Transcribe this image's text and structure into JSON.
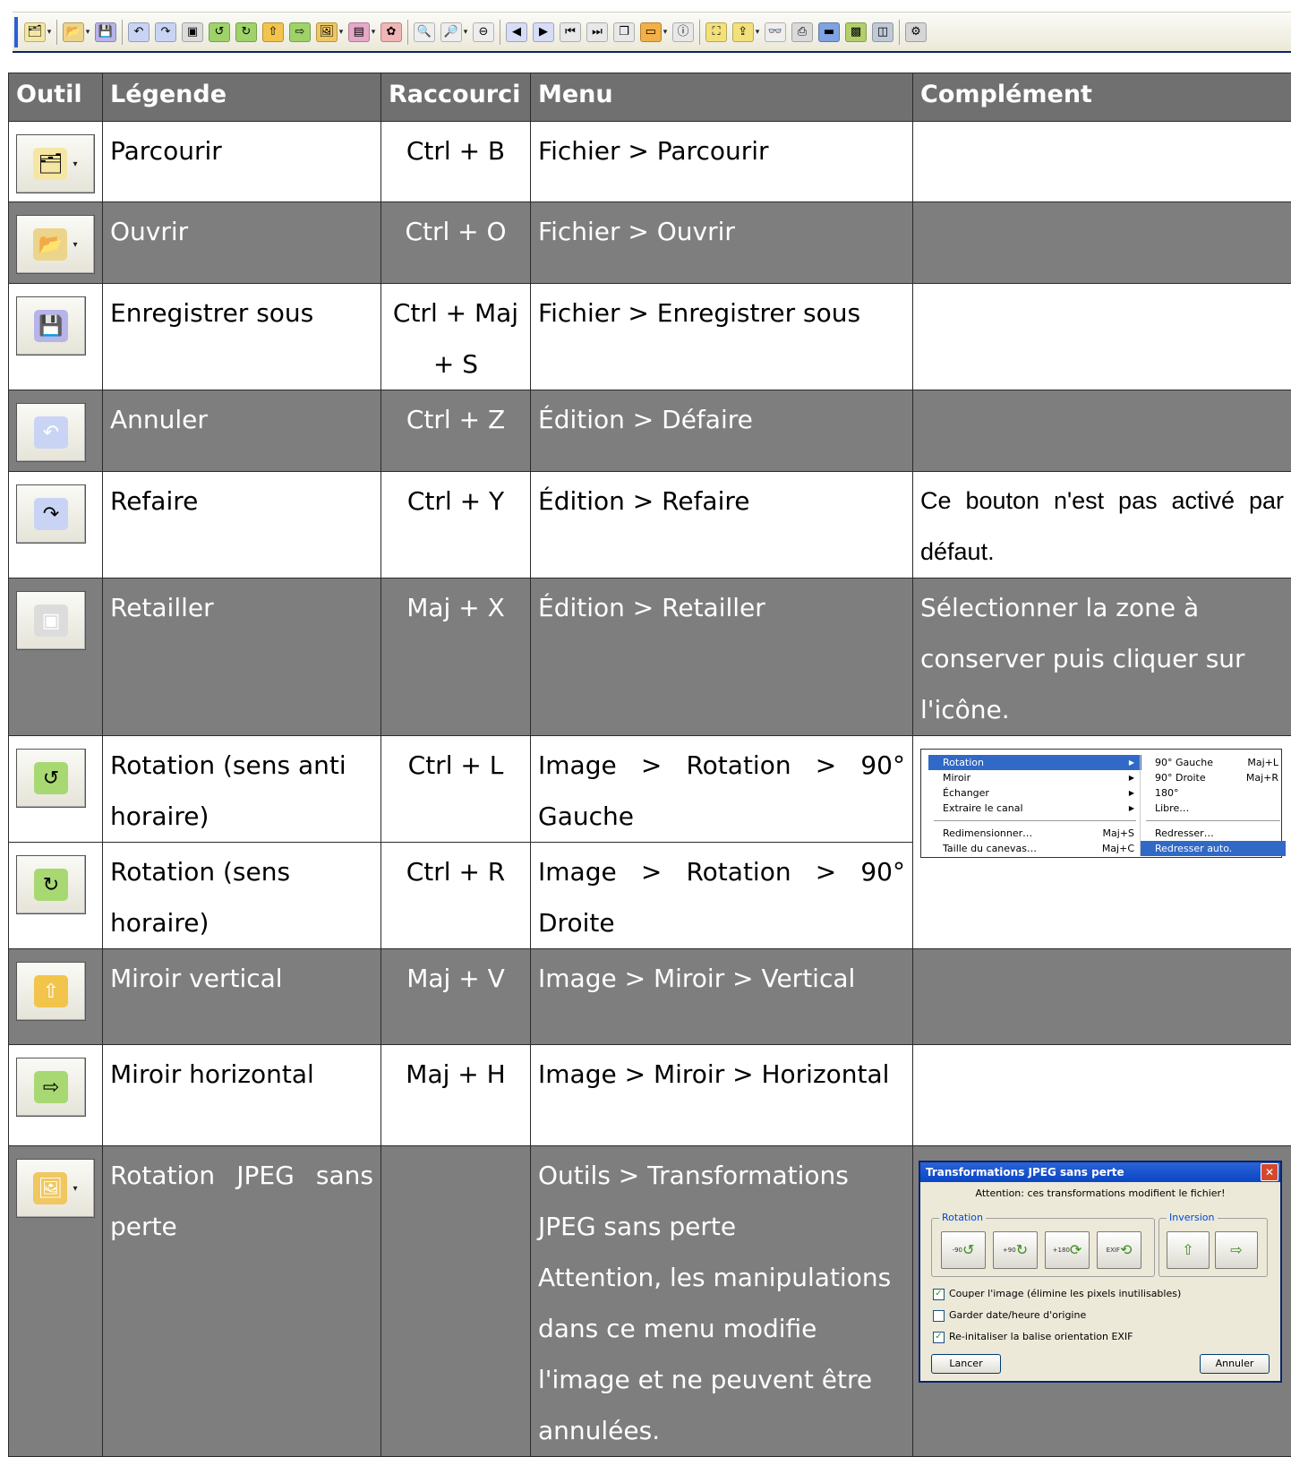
{
  "toolbar": {
    "items": [
      {
        "name": "browse-icon",
        "glyph": "🗂",
        "bg": "#f5e7a3",
        "dropdown": true
      },
      {
        "sep": true
      },
      {
        "name": "open-folder-icon",
        "glyph": "📂",
        "bg": "#ecd48a",
        "dropdown": true
      },
      {
        "name": "save-as-icon",
        "glyph": "💾",
        "bg": "#b7b4ea",
        "dropdown": false
      },
      {
        "sep": true
      },
      {
        "name": "undo-icon",
        "glyph": "↶",
        "bg": "#c9d4f5",
        "dropdown": false
      },
      {
        "name": "redo-icon",
        "glyph": "↷",
        "bg": "#c9d4f5",
        "dropdown": false
      },
      {
        "name": "crop-icon",
        "glyph": "▣",
        "bg": "#dcdcdc",
        "dropdown": false
      },
      {
        "name": "rotate-left-icon",
        "glyph": "↺",
        "bg": "#9fd36a",
        "dropdown": false
      },
      {
        "name": "rotate-right-icon",
        "glyph": "↻",
        "bg": "#9fd36a",
        "dropdown": false
      },
      {
        "name": "mirror-vertical-icon",
        "glyph": "⇧",
        "bg": "#f2c44b",
        "dropdown": false
      },
      {
        "name": "mirror-horizontal-icon",
        "glyph": "⇨",
        "bg": "#9fd36a",
        "dropdown": false
      },
      {
        "name": "jpeg-lossless-icon",
        "glyph": "🖼",
        "bg": "#f0c760",
        "dropdown": true
      },
      {
        "name": "color-icon",
        "glyph": "▤",
        "bg": "#e6a8c8",
        "dropdown": true
      },
      {
        "name": "effects-icon",
        "glyph": "✿",
        "bg": "#f0b5b5",
        "dropdown": false
      },
      {
        "sep": true
      },
      {
        "name": "zoom-in-icon",
        "glyph": "🔍",
        "bg": "#eeeeee",
        "dropdown": false
      },
      {
        "name": "zoom-fit-icon",
        "glyph": "🔎",
        "bg": "#eeeeee",
        "dropdown": true
      },
      {
        "name": "zoom-out-icon",
        "glyph": "⊖",
        "bg": "#eeeeee",
        "dropdown": false
      },
      {
        "sep": true
      },
      {
        "name": "previous-icon",
        "glyph": "◀",
        "bg": "#d7dcf7",
        "dropdown": false
      },
      {
        "name": "next-icon",
        "glyph": "▶",
        "bg": "#d7dcf7",
        "dropdown": false
      },
      {
        "name": "first-icon",
        "glyph": "⏮",
        "bg": "#e8e8e8",
        "dropdown": false
      },
      {
        "name": "last-icon",
        "glyph": "⏭",
        "bg": "#e8e8e8",
        "dropdown": false
      },
      {
        "name": "copy-window-icon",
        "glyph": "❐",
        "bg": "#e8e8e8",
        "dropdown": false
      },
      {
        "name": "slideshow-icon",
        "glyph": "▭",
        "bg": "#f2b048",
        "dropdown": true
      },
      {
        "name": "info-icon",
        "glyph": "ⓘ",
        "bg": "#e8e8e8",
        "dropdown": false
      },
      {
        "sep": true
      },
      {
        "name": "fullscreen-icon",
        "glyph": "⛶",
        "bg": "#f3e07a",
        "dropdown": false
      },
      {
        "name": "export-icon",
        "glyph": "⇪",
        "bg": "#f3e07a",
        "dropdown": true
      },
      {
        "name": "binoculars-icon",
        "glyph": "👓",
        "bg": "#eeeeee",
        "dropdown": false
      },
      {
        "name": "print-icon",
        "glyph": "⎙",
        "bg": "#dadada",
        "dropdown": false
      },
      {
        "name": "scan-icon",
        "glyph": "▬",
        "bg": "#7fa2e0",
        "dropdown": false
      },
      {
        "name": "thumbnails-icon",
        "glyph": "▩",
        "bg": "#b2cf6a",
        "dropdown": false
      },
      {
        "name": "wallpaper-icon",
        "glyph": "◫",
        "bg": "#c0c9d8",
        "dropdown": false
      },
      {
        "sep": true
      },
      {
        "name": "settings-icon",
        "glyph": "⚙",
        "bg": "#d6d6d6",
        "dropdown": false
      }
    ]
  },
  "table": {
    "headers": {
      "tool": "Outil",
      "caption": "Légende",
      "shortcut": "Raccourci",
      "menu": "Menu",
      "extra": "Complément"
    },
    "rows": [
      {
        "icon": "browse-icon",
        "glyph": "🗂",
        "icon_bg": "#f5e7a3",
        "dropdown": true,
        "caption": "Parcourir",
        "shortcut": "Ctrl + B",
        "menu": [
          "Fichier > Parcourir"
        ],
        "extra": []
      },
      {
        "icon": "open-folder-icon",
        "glyph": "📂",
        "icon_bg": "#ecd48a",
        "dropdown": true,
        "caption": "Ouvrir",
        "shortcut": "Ctrl + O",
        "menu": [
          "Fichier > Ouvrir"
        ],
        "extra": []
      },
      {
        "icon": "save-as-icon",
        "glyph": "💾",
        "icon_bg": "#b7b4ea",
        "dropdown": false,
        "caption": "Enregistrer sous",
        "shortcut": "Ctrl + Maj + S",
        "menu": [
          "Fichier > Enregistrer sous"
        ],
        "extra": []
      },
      {
        "icon": "undo-icon",
        "glyph": "↶",
        "icon_bg": "#c9d4f5",
        "dropdown": false,
        "caption": "Annuler",
        "shortcut": "Ctrl + Z",
        "menu": [
          "Édition > Défaire"
        ],
        "extra": []
      },
      {
        "icon": "redo-icon",
        "glyph": "↷",
        "icon_bg": "#c9d4f5",
        "dropdown": false,
        "caption": "Refaire",
        "shortcut": "Ctrl + Y",
        "menu": [
          "Édition > Refaire"
        ],
        "extra": [
          "Ce bouton n'est pas activé par défaut."
        ]
      },
      {
        "icon": "crop-icon",
        "glyph": "▣",
        "icon_bg": "#dcdcdc",
        "dropdown": false,
        "caption": "Retailler",
        "shortcut": "Maj + X",
        "menu": [
          "Édition > Retailler"
        ],
        "extra": [
          "Sélectionner la zone à conserver puis cliquer sur l'icône."
        ]
      },
      {
        "icon": "rotate-left-icon",
        "glyph": "↺",
        "icon_bg": "#a8d872",
        "dropdown": false,
        "caption": "Rotation (sens anti horaire)",
        "shortcut": "Ctrl + L",
        "menu": [
          "Image > Rotation > 90° Gauche"
        ],
        "extra": []
      },
      {
        "icon": "rotate-right-icon",
        "glyph": "↻",
        "icon_bg": "#a8d872",
        "dropdown": false,
        "caption": "Rotation (sens horaire)",
        "shortcut": "Ctrl + R",
        "menu": [
          "Image > Rotation > 90° Droite"
        ],
        "extra": []
      },
      {
        "icon": "mirror-vertical-icon",
        "glyph": "⇧",
        "icon_bg": "#f2c44b",
        "dropdown": false,
        "caption": "Miroir vertical",
        "shortcut": "Maj + V",
        "menu": [
          "Image > Miroir > Vertical"
        ],
        "extra": []
      },
      {
        "icon": "mirror-horizontal-icon",
        "glyph": "⇨",
        "icon_bg": "#a8d872",
        "dropdown": false,
        "caption": "Miroir horizontal",
        "shortcut": "Maj + H",
        "menu": [
          "Image > Miroir > Horizontal"
        ],
        "extra": []
      },
      {
        "icon": "jpeg-lossless-icon",
        "glyph": "🖼",
        "icon_bg": "#f0c760",
        "dropdown": true,
        "caption": "Rotation JPEG sans perte",
        "shortcut": "",
        "menu": [
          "Outils > Transformations JPEG sans perte",
          "Attention, les manipulations dans ce menu modifie l'image et ne peuvent être annulées."
        ],
        "extra": []
      }
    ]
  },
  "menu_screenshot": {
    "left": [
      {
        "label": "Rotation",
        "shortcut": "",
        "submenu": true,
        "highlighted": true
      },
      {
        "label": "Miroir",
        "shortcut": "",
        "submenu": true,
        "highlighted": false
      },
      {
        "label": "Échanger",
        "shortcut": "",
        "submenu": true,
        "highlighted": false
      },
      {
        "label": "Extraire le canal",
        "shortcut": "",
        "submenu": true,
        "highlighted": false
      },
      {
        "sep": true
      },
      {
        "label": "Redimensionner…",
        "shortcut": "Maj+S",
        "submenu": false,
        "highlighted": false
      },
      {
        "label": "Taille du canevas…",
        "shortcut": "Maj+C",
        "submenu": false,
        "highlighted": false
      }
    ],
    "right": [
      {
        "label": "90° Gauche",
        "shortcut": "Maj+L",
        "highlighted": false
      },
      {
        "label": "90° Droite",
        "shortcut": "Maj+R",
        "highlighted": false
      },
      {
        "label": "180°",
        "shortcut": "",
        "highlighted": false
      },
      {
        "label": "Libre…",
        "shortcut": "",
        "highlighted": false
      },
      {
        "sep": true
      },
      {
        "label": "Redresser…",
        "shortcut": "",
        "highlighted": false
      },
      {
        "label": "Redresser auto.",
        "shortcut": "",
        "highlighted": true
      }
    ]
  },
  "dialog_screenshot": {
    "title": "Transformations JPEG sans perte",
    "warning": "Attention: ces transformations modifient le fichier!",
    "rotation_group": "Rotation",
    "inversion_group": "Inversion",
    "rotation_buttons": [
      {
        "name": "rotate-minus-90-icon",
        "glyph": "↺",
        "tag": "-90"
      },
      {
        "name": "rotate-plus-90-icon",
        "glyph": "↻",
        "tag": "+90"
      },
      {
        "name": "rotate-180-icon",
        "glyph": "⟳",
        "tag": "+180"
      },
      {
        "name": "rotate-exif-icon",
        "glyph": "⟲",
        "tag": "EXIF"
      }
    ],
    "inversion_buttons": [
      {
        "name": "flip-vertical-icon",
        "glyph": "⇧"
      },
      {
        "name": "flip-horizontal-icon",
        "glyph": "⇨"
      }
    ],
    "checkboxes": [
      {
        "label": "Couper l'image (élimine les pixels inutilisables)",
        "checked": true
      },
      {
        "label": "Garder date/heure d'origine",
        "checked": false
      },
      {
        "label": "Re-initaliser la balise orientation EXIF",
        "checked": true
      }
    ],
    "ok_label": "Lancer",
    "cancel_label": "Annuler",
    "close_glyph": "✕"
  }
}
